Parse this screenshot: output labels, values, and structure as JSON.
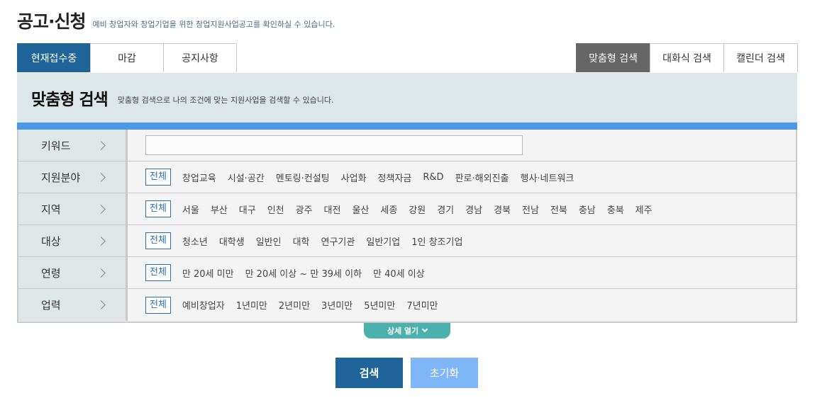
{
  "header": {
    "title": "공고·신청",
    "description": "예비 창업자와 창업기업을 위한 창업지원사업공고를 확인하실 수 있습니다."
  },
  "tabs_left": [
    "현재접수중",
    "마감",
    "공지사항"
  ],
  "tabs_right": [
    "맞춤형 검색",
    "대화식 검색",
    "캘린더 검색"
  ],
  "search_panel": {
    "title": "맞춤형 검색",
    "description": "맞춤형 검색으로 나의 조건에 맞는 지원사업을 검색할 수 있습니다."
  },
  "filters": {
    "keyword": {
      "label": "키워드",
      "value": ""
    },
    "field": {
      "label": "지원분야",
      "options": [
        "전체",
        "창업교육",
        "시설·공간",
        "멘토링·컨설팅",
        "사업화",
        "정책자금",
        "R&D",
        "판로·해외진출",
        "행사·네트워크"
      ]
    },
    "region": {
      "label": "지역",
      "options": [
        "전체",
        "서울",
        "부산",
        "대구",
        "인천",
        "광주",
        "대전",
        "울산",
        "세종",
        "강원",
        "경기",
        "경남",
        "경북",
        "전남",
        "전북",
        "충남",
        "충북",
        "제주"
      ]
    },
    "target": {
      "label": "대상",
      "options": [
        "전체",
        "청소년",
        "대학생",
        "일반인",
        "대학",
        "연구기관",
        "일반기업",
        "1인 창조기업"
      ]
    },
    "age": {
      "label": "연령",
      "options": [
        "전체",
        "만 20세 미만",
        "만 20세 이상 ~ 만 39세 이하",
        "만 40세 이상"
      ]
    },
    "career": {
      "label": "업력",
      "options": [
        "전체",
        "예비창업자",
        "1년미만",
        "2년미만",
        "3년미만",
        "5년미만",
        "7년미만"
      ]
    }
  },
  "detail_toggle": "상세 열기",
  "buttons": {
    "search": "검색",
    "reset": "초기화"
  },
  "colors": {
    "primary": "#1f6498",
    "accent_bar": "#4a98e8",
    "toggle": "#4cb1ad",
    "reset": "#7fb6f7",
    "active_right_tab": "#666666"
  }
}
